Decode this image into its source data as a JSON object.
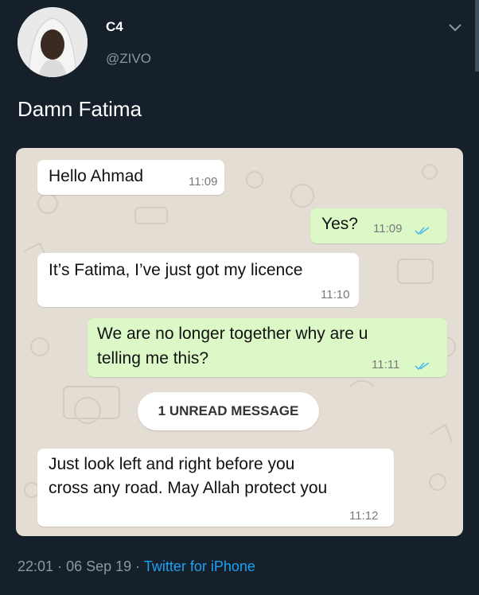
{
  "tweet": {
    "display_name": "C4",
    "handle": "@ZIVO",
    "text": "Damn Fatima",
    "time": "22:01",
    "dot1": "·",
    "date": "06 Sep 19",
    "dot2": "·",
    "source": "Twitter for iPhone"
  },
  "chat": {
    "messages": [
      {
        "direction": "incoming",
        "text": "Hello Ahmad",
        "time": "11:09"
      },
      {
        "direction": "outgoing",
        "text": "Yes?",
        "time": "11:09",
        "status": "read"
      },
      {
        "direction": "incoming",
        "text": "It’s Fatima, I’ve just got my licence",
        "time": "11:10"
      },
      {
        "direction": "outgoing",
        "lines": [
          "We are no longer together why are u",
          "telling me this?"
        ],
        "time": "11:11",
        "status": "read"
      },
      {
        "direction": "incoming",
        "lines": [
          "Just look left and right before you",
          "cross any road. May Allah protect you"
        ],
        "time": "11:12"
      }
    ],
    "unread_label": "1 UNREAD MESSAGE"
  },
  "colors": {
    "background": "#15202b",
    "muted_text": "#8899a6",
    "link": "#1da1f2",
    "outgoing_bubble": "#dcf8c6",
    "incoming_bubble": "#ffffff",
    "read_ticks": "#4fb6ec"
  },
  "icons": {
    "more": "chevron-down-icon",
    "read_receipt": "double-check-icon"
  }
}
